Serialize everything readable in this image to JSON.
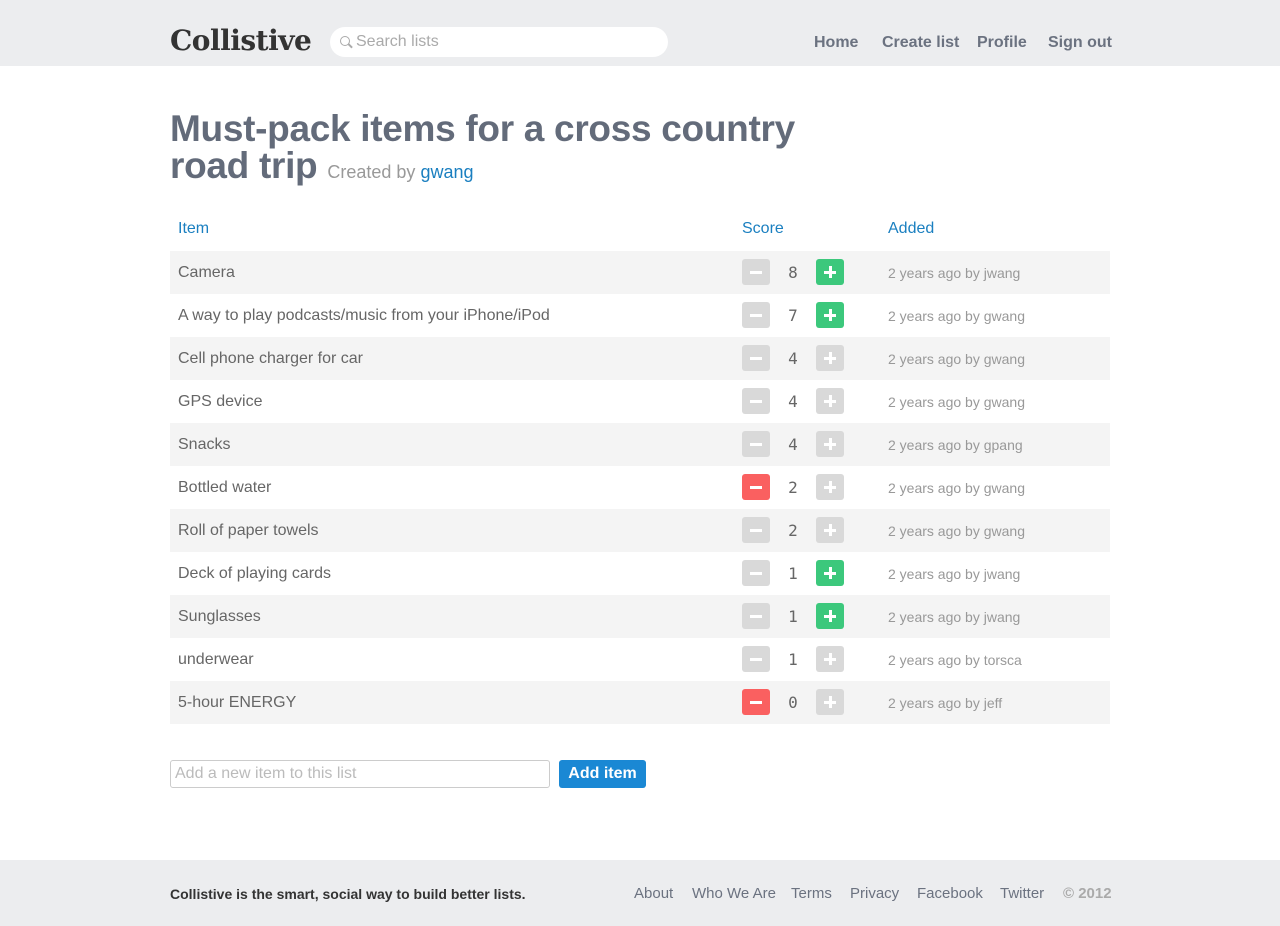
{
  "app": {
    "logo": "Collistive"
  },
  "search": {
    "placeholder": "Search lists"
  },
  "nav": {
    "home": "Home",
    "create": "Create list",
    "profile": "Profile",
    "signout": "Sign out"
  },
  "list": {
    "title": "Must-pack items for a cross country road trip",
    "created_prefix": "Created by",
    "creator": "gwang"
  },
  "table": {
    "headers": {
      "item": "Item",
      "score": "Score",
      "added": "Added"
    },
    "rows": [
      {
        "name": "Camera",
        "score": "8",
        "added": "2 years ago by jwang",
        "vote": "up"
      },
      {
        "name": "A way to play podcasts/music from your iPhone/iPod",
        "score": "7",
        "added": "2 years ago by gwang",
        "vote": "up"
      },
      {
        "name": "Cell phone charger for car",
        "score": "4",
        "added": "2 years ago by gwang",
        "vote": "none"
      },
      {
        "name": "GPS device",
        "score": "4",
        "added": "2 years ago by gwang",
        "vote": "none"
      },
      {
        "name": "Snacks",
        "score": "4",
        "added": "2 years ago by gpang",
        "vote": "none"
      },
      {
        "name": "Bottled water",
        "score": "2",
        "added": "2 years ago by gwang",
        "vote": "down"
      },
      {
        "name": "Roll of paper towels",
        "score": "2",
        "added": "2 years ago by gwang",
        "vote": "none"
      },
      {
        "name": "Deck of playing cards",
        "score": "1",
        "added": "2 years ago by jwang",
        "vote": "up"
      },
      {
        "name": "Sunglasses",
        "score": "1",
        "added": "2 years ago by jwang",
        "vote": "up"
      },
      {
        "name": "underwear",
        "score": "1",
        "added": "2 years ago by torsca",
        "vote": "none"
      },
      {
        "name": "5-hour ENERGY",
        "score": "0",
        "added": "2 years ago by jeff",
        "vote": "down"
      }
    ]
  },
  "add_form": {
    "placeholder": "Add a new item to this list",
    "button": "Add item"
  },
  "footer": {
    "tagline": "Collistive is the smart, social way to build better lists.",
    "links": {
      "about": "About",
      "who": "Who We Are",
      "terms": "Terms",
      "privacy": "Privacy",
      "facebook": "Facebook",
      "twitter": "Twitter"
    },
    "copyright": "© 2012"
  },
  "colors": {
    "upvote_active": "#3cc87c",
    "downvote_active": "#fa6060",
    "vote_inactive": "#d9d9d9",
    "link": "#1a7fc0",
    "button": "#1a88d4"
  }
}
